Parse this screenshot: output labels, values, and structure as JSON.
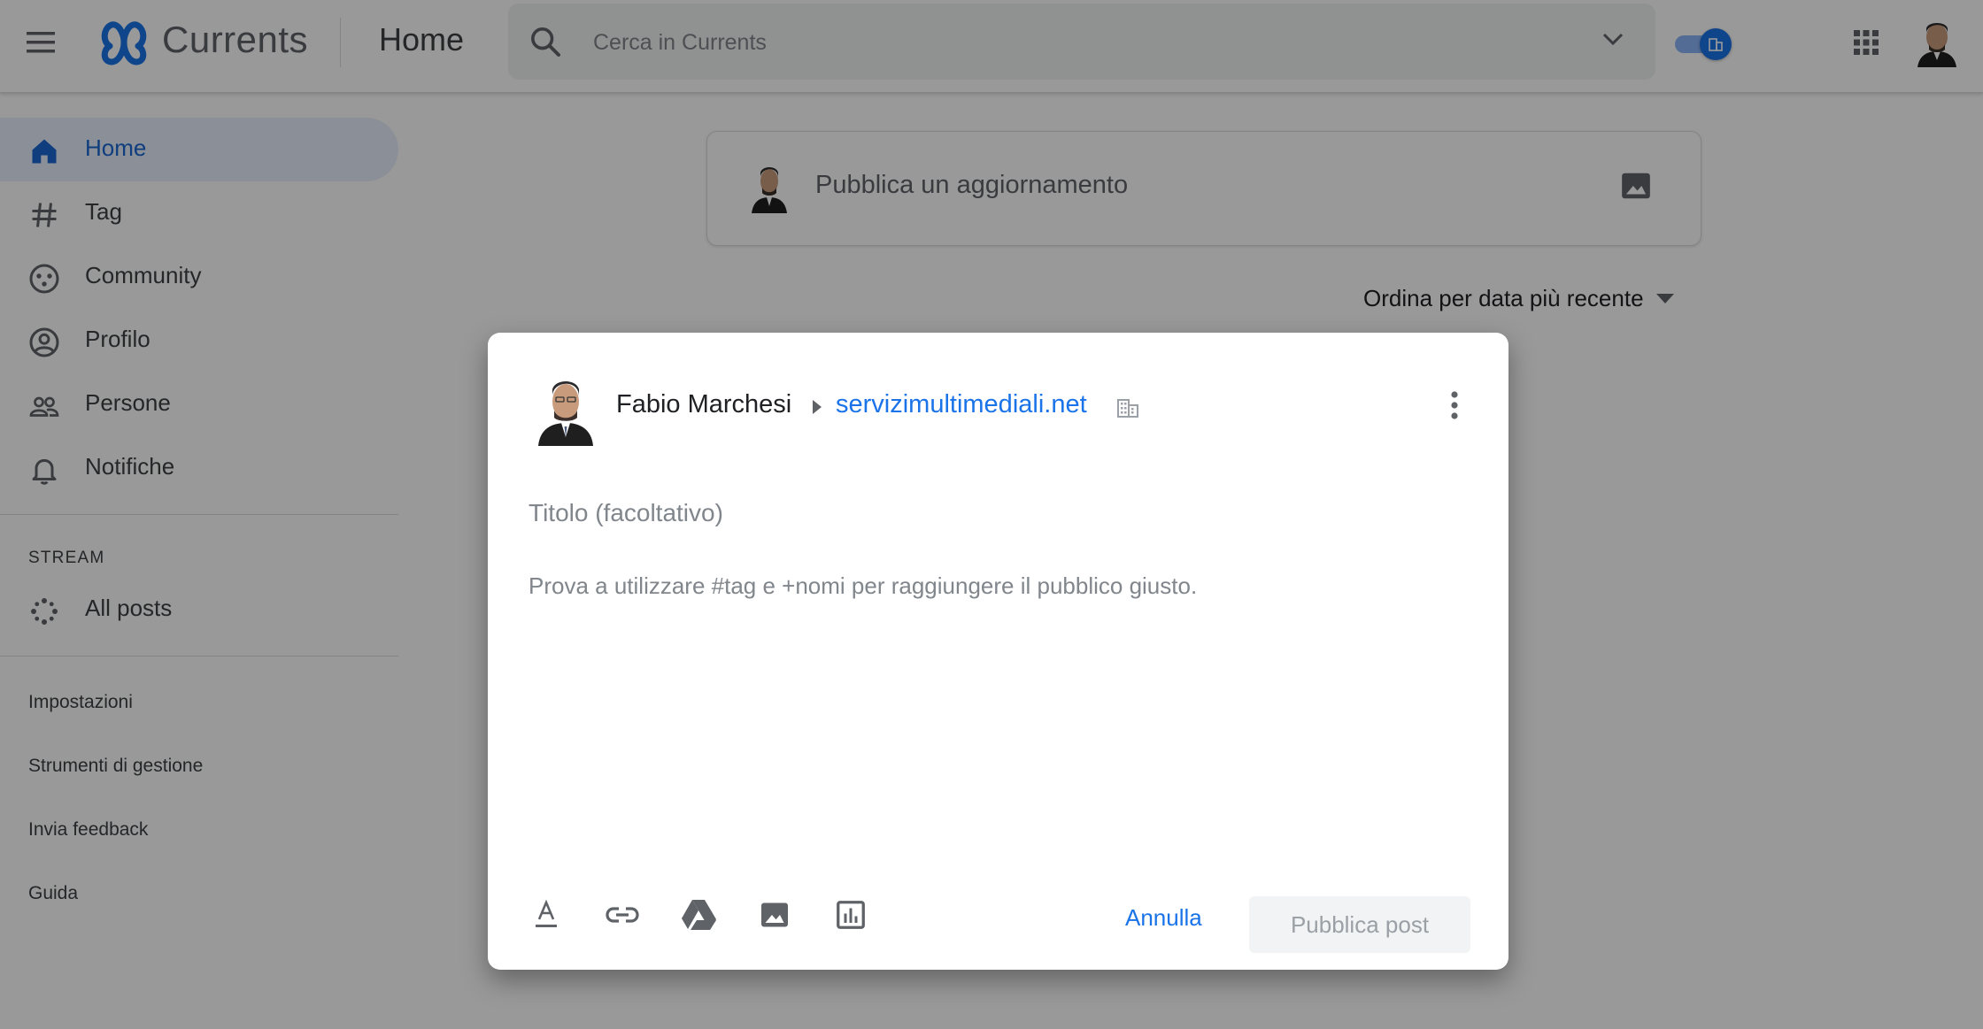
{
  "header": {
    "app_name": "Currents",
    "page_title": "Home",
    "search_placeholder": "Cerca in Currents"
  },
  "sidebar": {
    "items": [
      {
        "label": "Home",
        "icon": "home-icon",
        "active": true
      },
      {
        "label": "Tag",
        "icon": "hashtag-icon"
      },
      {
        "label": "Community",
        "icon": "community-icon"
      },
      {
        "label": "Profilo",
        "icon": "profile-icon"
      },
      {
        "label": "Persone",
        "icon": "people-icon"
      },
      {
        "label": "Notifiche",
        "icon": "bell-icon"
      }
    ],
    "stream_heading": "STREAM",
    "stream_item": {
      "label": "All posts",
      "icon": "all-posts-icon"
    },
    "links": [
      "Impostazioni",
      "Strumenti di gestione",
      "Invia feedback",
      "Guida"
    ]
  },
  "main": {
    "composer_placeholder": "Pubblica un aggiornamento",
    "sort_label": "Ordina per data più recente"
  },
  "dialog": {
    "author": "Fabio Marchesi",
    "domain": "servizimultimediali.net",
    "title_placeholder": "Titolo (facoltativo)",
    "body_placeholder": "Prova a utilizzare #tag e +nomi per raggiungere il pubblico giusto.",
    "cancel_label": "Annulla",
    "publish_label": "Pubblica post",
    "toolbar_icons": [
      "text-format-icon",
      "link-icon",
      "drive-icon",
      "image-icon",
      "poll-icon"
    ]
  },
  "colors": {
    "accent": "#1a73e8",
    "active_nav_bg": "#e8f0fe",
    "scrim": "rgba(0,0,0,0.40)"
  }
}
